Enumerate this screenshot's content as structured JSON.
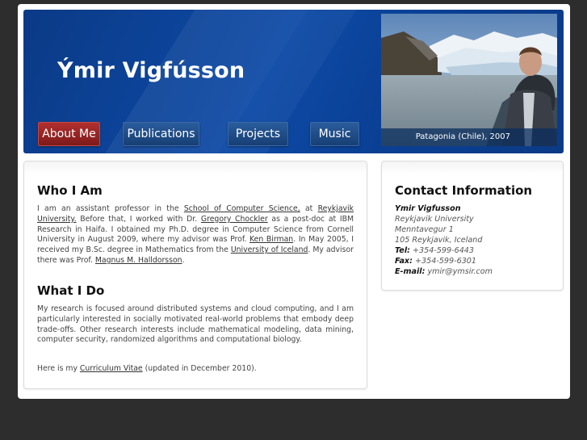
{
  "site": {
    "title": "Ýmir Vigfússon"
  },
  "nav": {
    "items": [
      {
        "label": "About Me"
      },
      {
        "label": "Publications"
      },
      {
        "label": "Projects"
      },
      {
        "label": "Music"
      }
    ]
  },
  "photo": {
    "caption": "Patagonia (Chile), 2007"
  },
  "who": {
    "heading": "Who I Am",
    "t1": "I am an assistant professor in the ",
    "l1": "School of Computer Science,",
    "t2": " at ",
    "l2": "Reykjavik University.",
    "t3": " Before that, I worked with Dr. ",
    "l3": "Gregory Chockler",
    "t4": " as a post-doc at IBM Research in Haifa. I obtained my Ph.D. degree in Computer Science from Cornell University in August 2009, where my advisor was Prof. ",
    "l4": "Ken Birman",
    "t5": ". In May 2005, I received my B.Sc. degree in Mathematics from the ",
    "l5": "University of Iceland",
    "t6": ". My advisor there was Prof. ",
    "l6": "Magnus M. Halldorsson",
    "t7": "."
  },
  "what": {
    "heading": "What I Do",
    "text": "My research is focused around distributed systems and cloud computing, and I am particularly interested in socially motivated real-world problems that embody deep trade-offs. Other research interests include mathematical modeling, data mining, computer security, randomized algorithms and computational biology.",
    "cv_prefix": "Here is my ",
    "cv_link": "Curriculum Vitae",
    "cv_suffix": " (updated in December 2010)."
  },
  "contact": {
    "heading": "Contact Information",
    "name": "Ymir Vigfusson",
    "org": "Reykjavik University",
    "street": "Menntavegur 1",
    "city": "105 Reykjavik, Iceland",
    "tel_label": "Tel:",
    "tel": "+354-599-6443",
    "fax_label": "Fax:",
    "fax": "+354-599-6301",
    "email_label": "E-mail:",
    "email": "ymir@ymsir.com"
  }
}
